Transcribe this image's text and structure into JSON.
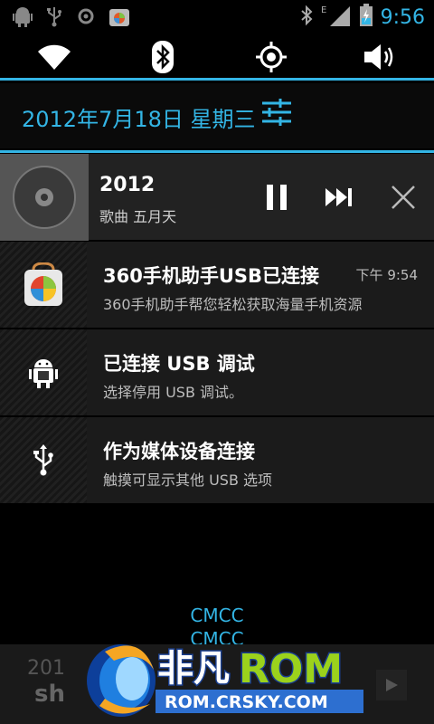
{
  "status_bar": {
    "time": "9:56",
    "left_icons": [
      "android-debug-icon",
      "usb-icon",
      "sync-icon",
      "app-store-icon"
    ],
    "right_icons": [
      "bluetooth-icon",
      "signal-icon",
      "battery-charging-icon"
    ],
    "network_type": "E"
  },
  "quick_toggles": [
    {
      "name": "wifi",
      "icon": "wifi-icon"
    },
    {
      "name": "bluetooth",
      "icon": "bluetooth-icon"
    },
    {
      "name": "gps",
      "icon": "gps-icon"
    },
    {
      "name": "sound",
      "icon": "volume-icon"
    }
  ],
  "date_row": {
    "date": "2012年7月18日 星期三",
    "settings_icon": "settings-sliders-icon"
  },
  "music": {
    "title": "2012",
    "subtitle": "歌曲 五月天",
    "controls": [
      "pause-icon",
      "next-icon",
      "close-icon"
    ]
  },
  "notifications": [
    {
      "title": "360手机助手USB已连接",
      "subtitle": "360手机助手帮您轻松获取海量手机资源",
      "time": "下午 9:54",
      "icon": "360-assistant-icon"
    },
    {
      "title": "已连接 USB 调试",
      "subtitle": "选择停用 USB 调试。",
      "time": "",
      "icon": "android-debug-icon"
    },
    {
      "title": "作为媒体设备连接",
      "subtitle": "触摸可显示其他 USB 选项",
      "time": "",
      "icon": "usb-icon"
    }
  ],
  "carrier": [
    "CMCC",
    "CMCC"
  ],
  "watermark": {
    "brand_cn": "非凡",
    "brand_en": "ROM",
    "url": "ROM.CRSKY.COM",
    "left_fragment": "201",
    "left_fragment2": "sh"
  },
  "colors": {
    "accent": "#33b5e5",
    "background": "#000000",
    "notification_bg": "#1b1b1b",
    "logo_green": "#9bd21c"
  }
}
